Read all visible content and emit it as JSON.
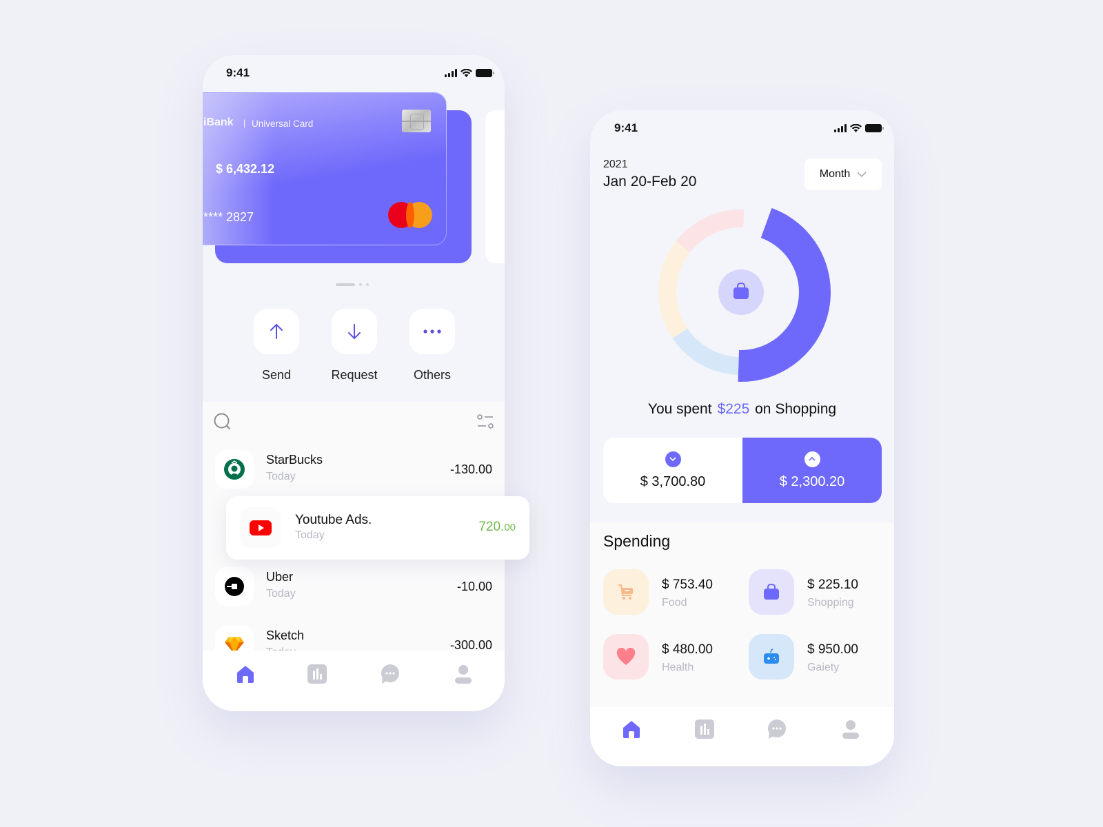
{
  "colors": {
    "accent": "#6f69fb",
    "positive": "#6dbb4c",
    "muted": "#b8b9c2",
    "tab_inactive": "#cacbd3"
  },
  "phone_wallet": {
    "status": {
      "time": "9:41"
    },
    "card": {
      "bank": "iBank",
      "separator": "|",
      "type": "Universal Card",
      "balance": "$ 6,432.12",
      "number": "**** 2827",
      "network_icon": "mastercard-logo"
    },
    "pager": {
      "active_index": 0,
      "count": 3
    },
    "actions": [
      {
        "label": "Send",
        "icon": "arrow-up-icon"
      },
      {
        "label": "Request",
        "icon": "arrow-down-icon"
      },
      {
        "label": "Others",
        "icon": "more-dots-icon"
      }
    ],
    "transactions": [
      {
        "name": "StarBucks",
        "date": "Today",
        "amount": "-130.00",
        "icon": "starbucks-logo"
      },
      {
        "name": "Youtube Ads.",
        "date": "Today",
        "amount_main": "720.",
        "amount_cents": "00",
        "icon": "youtube-logo"
      },
      {
        "name": "Uber",
        "date": "Today",
        "amount": "-10.00",
        "icon": "uber-logo"
      },
      {
        "name": "Sketch",
        "date": "Today",
        "amount": "-300.00",
        "icon": "sketch-logo"
      }
    ],
    "tabs": [
      {
        "name": "home",
        "active": true
      },
      {
        "name": "stats",
        "active": false
      },
      {
        "name": "messages",
        "active": false
      },
      {
        "name": "profile",
        "active": false
      }
    ]
  },
  "phone_stats": {
    "status": {
      "time": "9:41"
    },
    "year": "2021",
    "range": "Jan 20-Feb 20",
    "period_select": {
      "value": "Month"
    },
    "donut": {
      "segments": [
        {
          "category": "Shopping",
          "share": 0.45,
          "color": "#6f69fb"
        },
        {
          "category": "Gaiety",
          "share": 0.15,
          "color": "#d5e7f8"
        },
        {
          "category": "Food",
          "share": 0.2,
          "color": "#fdf0dd"
        },
        {
          "category": "Health",
          "share": 0.15,
          "color": "#fce4e6"
        }
      ],
      "center_icon": "shopping-bag-icon"
    },
    "spent": {
      "prefix": "You spent",
      "amount": "$225",
      "suffix": "on Shopping"
    },
    "toggle": {
      "expense": {
        "amount": "$ 3,700.80",
        "icon": "chevron-down-icon"
      },
      "income": {
        "amount": "$ 2,300.20",
        "icon": "chevron-up-icon",
        "selected": true
      }
    },
    "spending": {
      "title": "Spending",
      "categories": [
        {
          "amount": "$ 753.40",
          "label": "Food",
          "icon": "cart-icon",
          "bg": "#fdf0dd",
          "fg": "#f9b98a"
        },
        {
          "amount": "$ 225.10",
          "label": "Shopping",
          "icon": "shopping-bag-icon",
          "bg": "#e4e3fb",
          "fg": "#6f69fb"
        },
        {
          "amount": "$ 480.00",
          "label": "Health",
          "icon": "heart-icon",
          "bg": "#fce4e6",
          "fg": "#ff7f8a"
        },
        {
          "amount": "$ 950.00",
          "label": "Gaiety",
          "icon": "gamepad-icon",
          "bg": "#d5e7f8",
          "fg": "#2c8cf0"
        }
      ]
    },
    "tabs": [
      {
        "name": "home",
        "active": true
      },
      {
        "name": "stats",
        "active": false
      },
      {
        "name": "messages",
        "active": false
      },
      {
        "name": "profile",
        "active": false
      }
    ]
  }
}
